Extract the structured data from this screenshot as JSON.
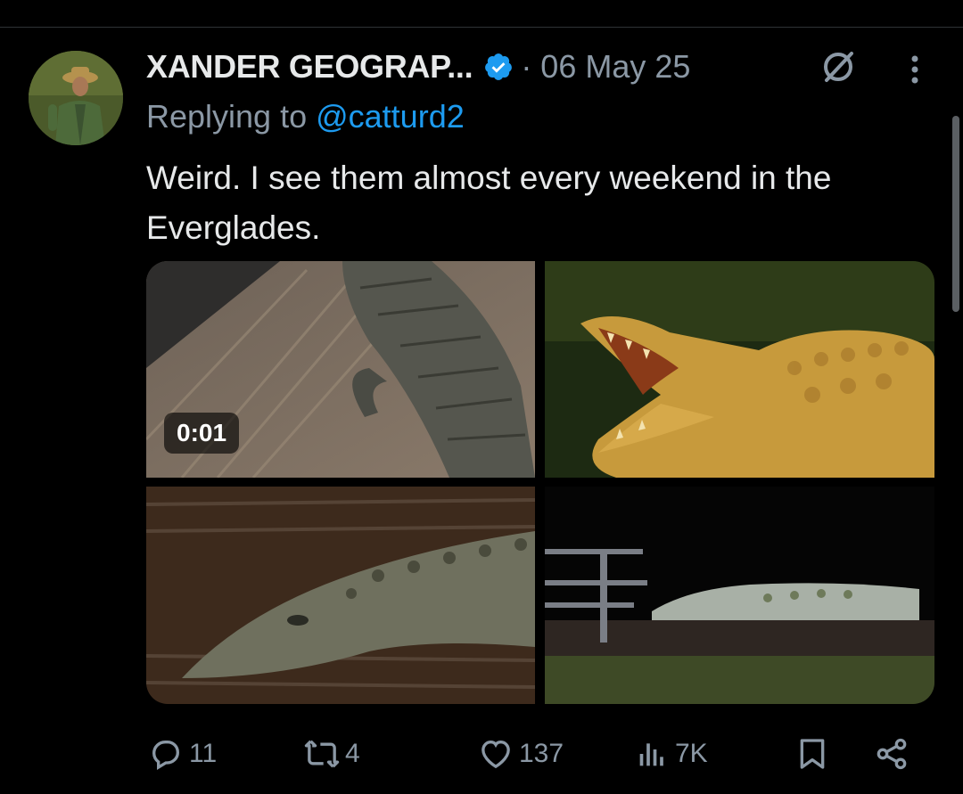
{
  "tweet": {
    "display_name": "XANDER GEOGRAP...",
    "separator_date": "· 06 May 25",
    "reply_prefix": "Replying to ",
    "reply_handle": "@catturd2",
    "text": "Weird. I see them almost every weekend in the Everglades.",
    "verified_color": "#1d9bf0"
  },
  "media": {
    "video_duration": "0:01",
    "images": [
      "crocodile-on-ramp-video",
      "crocodile-open-jaws",
      "crocodile-swimming",
      "crocodile-at-night"
    ]
  },
  "actions": {
    "replies": "11",
    "reposts": "4",
    "likes": "137",
    "views": "7K"
  },
  "icons": [
    "verified-badge-icon",
    "grok-icon",
    "more-icon",
    "reply-icon",
    "repost-icon",
    "like-icon",
    "views-icon",
    "bookmark-icon",
    "share-icon"
  ],
  "colors": {
    "background": "#000000",
    "text": "#e7e9ea",
    "muted": "#8b98a5",
    "link": "#1d9bf0"
  }
}
